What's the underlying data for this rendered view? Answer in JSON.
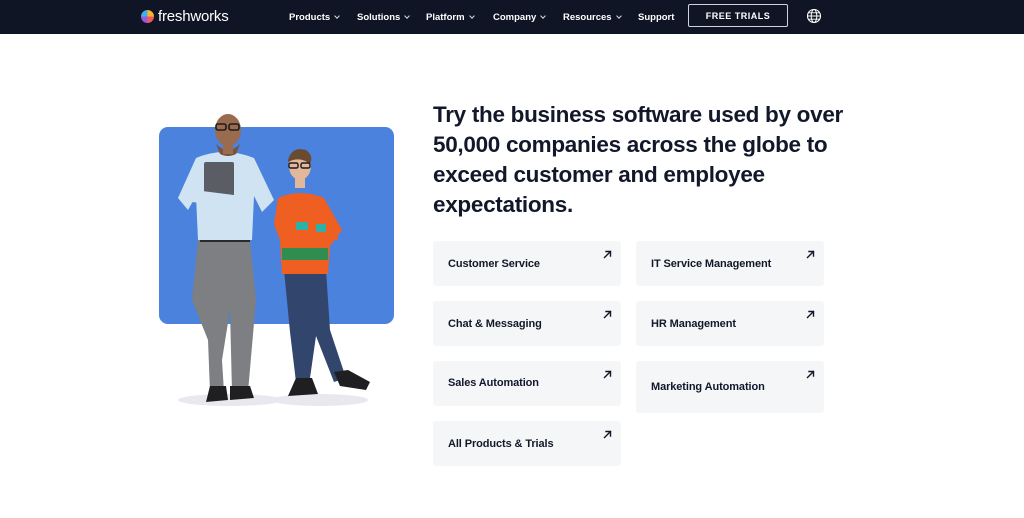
{
  "nav": {
    "brand": "freshworks",
    "items": [
      {
        "label": "Products"
      },
      {
        "label": "Solutions"
      },
      {
        "label": "Platform"
      },
      {
        "label": "Company"
      },
      {
        "label": "Resources"
      },
      {
        "label": "Support"
      }
    ],
    "cta": "FREE TRIALS",
    "globe_icon": "globe-icon"
  },
  "hero": {
    "headline": "Try the business software used by over 50,000 companies across the globe to exceed customer and employee expectations.",
    "background_color": "#4a82dd"
  },
  "cards": [
    {
      "label": "Customer Service"
    },
    {
      "label": "IT Service Management"
    },
    {
      "label": "Chat & Messaging"
    },
    {
      "label": "HR Management"
    },
    {
      "label": "Sales Automation"
    },
    {
      "label": "Marketing Automation"
    },
    {
      "label": "All Products & Trials"
    }
  ],
  "colors": {
    "nav_bg": "#0f1524",
    "card_bg": "#f5f6f7",
    "text": "#12182a"
  }
}
